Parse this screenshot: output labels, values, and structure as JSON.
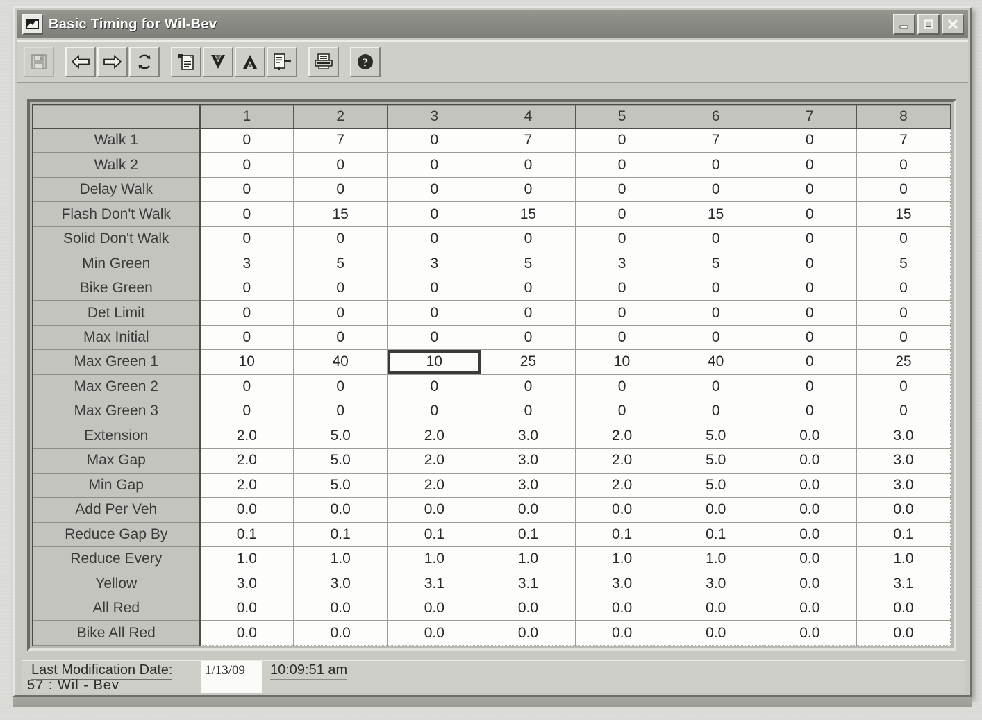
{
  "window": {
    "title": "Basic Timing for Wil-Bev",
    "icon": "app-window-icon",
    "controls": {
      "minimize": "minimize-icon",
      "maximize": "maximize-icon",
      "close": "close-icon"
    }
  },
  "toolbar": {
    "buttons": [
      {
        "name": "save-button",
        "icon": "floppy-disk-icon",
        "title": "Save",
        "disabled": true
      },
      {
        "name": "previous-button",
        "icon": "arrow-left-icon",
        "title": "Previous",
        "disabled": false
      },
      {
        "name": "next-button",
        "icon": "arrow-right-icon",
        "title": "Next",
        "disabled": false
      },
      {
        "name": "refresh-button",
        "icon": "refresh-icon",
        "title": "Refresh",
        "disabled": false
      },
      {
        "name": "copy-button",
        "icon": "copy-document-icon",
        "title": "Copy",
        "disabled": false
      },
      {
        "name": "move-down-button",
        "icon": "arrow-down-v-icon",
        "title": "Down",
        "disabled": false
      },
      {
        "name": "move-up-button",
        "icon": "arrow-up-a-icon",
        "title": "Up",
        "disabled": false
      },
      {
        "name": "paste-button",
        "icon": "document-transfer-icon",
        "title": "Transfer",
        "disabled": false
      },
      {
        "name": "print-button",
        "icon": "printer-icon",
        "title": "Print",
        "disabled": false
      },
      {
        "name": "help-button",
        "icon": "help-question-icon",
        "title": "Help",
        "disabled": false
      }
    ]
  },
  "table": {
    "corner_label": "",
    "columns": [
      "1",
      "2",
      "3",
      "4",
      "5",
      "6",
      "7",
      "8"
    ],
    "selected": {
      "row": 9,
      "col": 2
    },
    "rows": [
      {
        "label": "Walk 1",
        "values": [
          "0",
          "7",
          "0",
          "7",
          "0",
          "7",
          "0",
          "7"
        ]
      },
      {
        "label": "Walk 2",
        "values": [
          "0",
          "0",
          "0",
          "0",
          "0",
          "0",
          "0",
          "0"
        ]
      },
      {
        "label": "Delay Walk",
        "values": [
          "0",
          "0",
          "0",
          "0",
          "0",
          "0",
          "0",
          "0"
        ]
      },
      {
        "label": "Flash Don't Walk",
        "values": [
          "0",
          "15",
          "0",
          "15",
          "0",
          "15",
          "0",
          "15"
        ]
      },
      {
        "label": "Solid Don't Walk",
        "values": [
          "0",
          "0",
          "0",
          "0",
          "0",
          "0",
          "0",
          "0"
        ]
      },
      {
        "label": "Min Green",
        "values": [
          "3",
          "5",
          "3",
          "5",
          "3",
          "5",
          "0",
          "5"
        ]
      },
      {
        "label": "Bike Green",
        "values": [
          "0",
          "0",
          "0",
          "0",
          "0",
          "0",
          "0",
          "0"
        ]
      },
      {
        "label": "Det Limit",
        "values": [
          "0",
          "0",
          "0",
          "0",
          "0",
          "0",
          "0",
          "0"
        ]
      },
      {
        "label": "Max Initial",
        "values": [
          "0",
          "0",
          "0",
          "0",
          "0",
          "0",
          "0",
          "0"
        ]
      },
      {
        "label": "Max Green 1",
        "values": [
          "10",
          "40",
          "10",
          "25",
          "10",
          "40",
          "0",
          "25"
        ]
      },
      {
        "label": "Max Green 2",
        "values": [
          "0",
          "0",
          "0",
          "0",
          "0",
          "0",
          "0",
          "0"
        ]
      },
      {
        "label": "Max Green 3",
        "values": [
          "0",
          "0",
          "0",
          "0",
          "0",
          "0",
          "0",
          "0"
        ]
      },
      {
        "label": "Extension",
        "values": [
          "2.0",
          "5.0",
          "2.0",
          "3.0",
          "2.0",
          "5.0",
          "0.0",
          "3.0"
        ]
      },
      {
        "label": "Max Gap",
        "values": [
          "2.0",
          "5.0",
          "2.0",
          "3.0",
          "2.0",
          "5.0",
          "0.0",
          "3.0"
        ]
      },
      {
        "label": "Min Gap",
        "values": [
          "2.0",
          "5.0",
          "2.0",
          "3.0",
          "2.0",
          "5.0",
          "0.0",
          "3.0"
        ]
      },
      {
        "label": "Add Per Veh",
        "values": [
          "0.0",
          "0.0",
          "0.0",
          "0.0",
          "0.0",
          "0.0",
          "0.0",
          "0.0"
        ]
      },
      {
        "label": "Reduce Gap By",
        "values": [
          "0.1",
          "0.1",
          "0.1",
          "0.1",
          "0.1",
          "0.1",
          "0.0",
          "0.1"
        ]
      },
      {
        "label": "Reduce Every",
        "values": [
          "1.0",
          "1.0",
          "1.0",
          "1.0",
          "1.0",
          "1.0",
          "0.0",
          "1.0"
        ]
      },
      {
        "label": "Yellow",
        "values": [
          "3.0",
          "3.0",
          "3.1",
          "3.1",
          "3.0",
          "3.0",
          "0.0",
          "3.1"
        ]
      },
      {
        "label": "All Red",
        "values": [
          "0.0",
          "0.0",
          "0.0",
          "0.0",
          "0.0",
          "0.0",
          "0.0",
          "0.0"
        ]
      },
      {
        "label": "Bike All Red",
        "values": [
          "0.0",
          "0.0",
          "0.0",
          "0.0",
          "0.0",
          "0.0",
          "0.0",
          "0.0"
        ]
      }
    ]
  },
  "statusbar": {
    "last_modification_label": "Last Modification Date:",
    "last_modification_date": "1/13/09",
    "last_modification_time": "10:09:51 am",
    "record": "57  :   Wil - Bev"
  }
}
